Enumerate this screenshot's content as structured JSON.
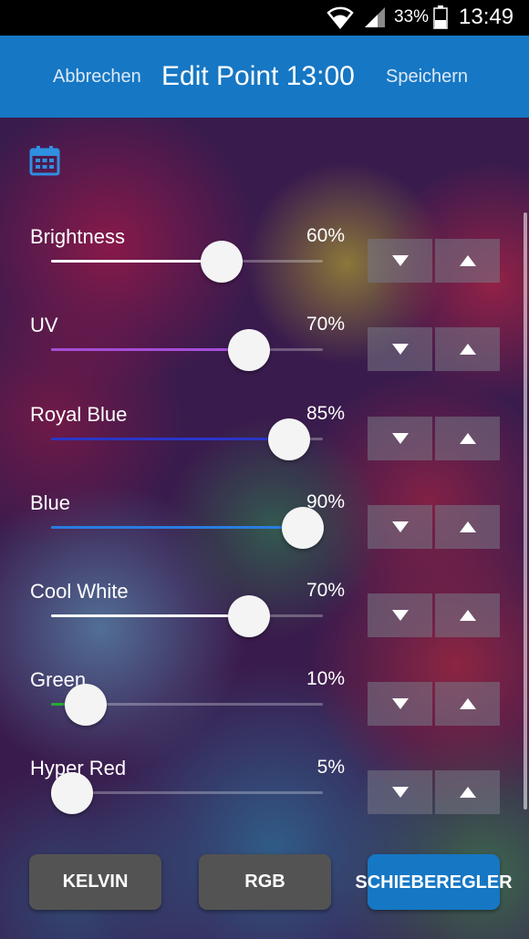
{
  "status_bar": {
    "battery_percent": "33%",
    "time": "13:49"
  },
  "header": {
    "cancel_label": "Abbrechen",
    "title": "Edit Point 13:00",
    "save_label": "Speichern"
  },
  "channels": [
    {
      "name": "Brightness",
      "value_text": "60%",
      "value": 60,
      "color": "#ffffff"
    },
    {
      "name": "UV",
      "value_text": "70%",
      "value": 70,
      "color": "#a64dd8"
    },
    {
      "name": "Royal Blue",
      "value_text": "85%",
      "value": 85,
      "color": "#2a36c8"
    },
    {
      "name": "Blue",
      "value_text": "90%",
      "value": 90,
      "color": "#2a7de0"
    },
    {
      "name": "Cool White",
      "value_text": "70%",
      "value": 70,
      "color": "#ffffff"
    },
    {
      "name": "Green",
      "value_text": "10%",
      "value": 10,
      "color": "#2aa838"
    },
    {
      "name": "Hyper Red",
      "value_text": "5%",
      "value": 5,
      "color": "#c8283a"
    }
  ],
  "bottom_buttons": {
    "kelvin": "KELVIN",
    "rgb": "RGB",
    "slider": "SCHIEBEREGLER"
  },
  "icons": {
    "calendar": "calendar-icon",
    "down": "triangle-down-icon",
    "up": "triangle-up-icon"
  },
  "colors": {
    "header": "#1677c4",
    "active_button": "#1677c4",
    "inactive_button": "#535353"
  }
}
